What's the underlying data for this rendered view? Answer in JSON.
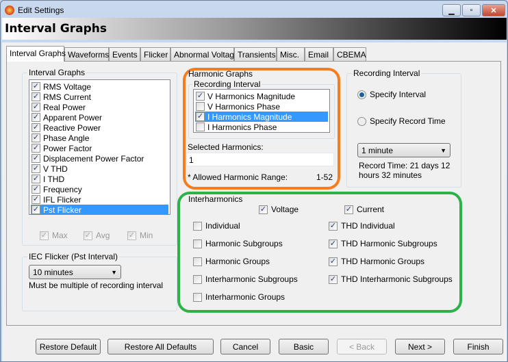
{
  "window": {
    "title": "Edit Settings",
    "banner": "Interval Graphs"
  },
  "tabs": [
    "Interval Graphs",
    "Waveforms",
    "Events",
    "Flicker",
    "Abnormal Voltage",
    "Transients",
    "Misc.",
    "Email",
    "CBEMA"
  ],
  "interval_graphs": {
    "label": "Interval Graphs",
    "items": [
      {
        "label": "RMS Voltage",
        "checked": true
      },
      {
        "label": "RMS Current",
        "checked": true
      },
      {
        "label": "Real Power",
        "checked": true
      },
      {
        "label": "Apparent Power",
        "checked": true
      },
      {
        "label": "Reactive Power",
        "checked": true
      },
      {
        "label": "Phase Angle",
        "checked": true
      },
      {
        "label": "Power Factor",
        "checked": true
      },
      {
        "label": "Displacement Power Factor",
        "checked": true
      },
      {
        "label": "V THD",
        "checked": true
      },
      {
        "label": "I THD",
        "checked": true
      },
      {
        "label": "Frequency",
        "checked": true
      },
      {
        "label": "IFL Flicker",
        "checked": true
      },
      {
        "label": "Pst Flicker",
        "checked": true,
        "selected": true
      }
    ],
    "max": "Max",
    "avg": "Avg",
    "min": "Min"
  },
  "iec_flicker": {
    "label": "IEC Flicker (Pst Interval)",
    "value": "10 minutes",
    "note": "Must be multiple of recording interval"
  },
  "harmonic_graphs": {
    "label": "Harmonic Graphs",
    "sub_label": "Recording Interval",
    "items": [
      {
        "label": "V Harmonics Magnitude",
        "checked": true
      },
      {
        "label": "V Harmonics Phase",
        "checked": false
      },
      {
        "label": "I Harmonics Magnitude",
        "checked": true,
        "selected": true
      },
      {
        "label": "I Harmonics Phase",
        "checked": false
      }
    ],
    "selected_label": "Selected Harmonics:",
    "selected_value": "1",
    "range_label": "* Allowed Harmonic Range:",
    "range_value": "1-52"
  },
  "recording_interval": {
    "label": "Recording Interval",
    "specify_interval": "Specify Interval",
    "specify_record_time": "Specify Record Time",
    "selected_mode": "Specify Interval",
    "interval_value": "1 minute",
    "record_time": "Record Time: 21 days 12 hours 32 minutes"
  },
  "interharmonics": {
    "label": "Interharmonics",
    "voltage": {
      "label": "Voltage",
      "checked": true
    },
    "current": {
      "label": "Current",
      "checked": true
    },
    "left": [
      {
        "label": "Individual",
        "checked": false
      },
      {
        "label": "Harmonic Subgroups",
        "checked": false
      },
      {
        "label": "Harmonic Groups",
        "checked": false
      },
      {
        "label": "Interharmonic Subgroups",
        "checked": false
      },
      {
        "label": "Interharmonic Groups",
        "checked": false
      }
    ],
    "right": [
      {
        "label": "THD Individual",
        "checked": true
      },
      {
        "label": "THD Harmonic Subgroups",
        "checked": true
      },
      {
        "label": "THD Harmonic Groups",
        "checked": true
      },
      {
        "label": "THD Interharmonic Subgroups",
        "checked": true
      }
    ]
  },
  "highlights": {
    "harmonic": "#f47d20",
    "interharmonic": "#2bb34a"
  },
  "buttons": {
    "restore_default": "Restore Default",
    "restore_all": "Restore All Defaults",
    "cancel": "Cancel",
    "basic": "Basic",
    "back": "< Back",
    "next": "Next >",
    "finish": "Finish"
  }
}
